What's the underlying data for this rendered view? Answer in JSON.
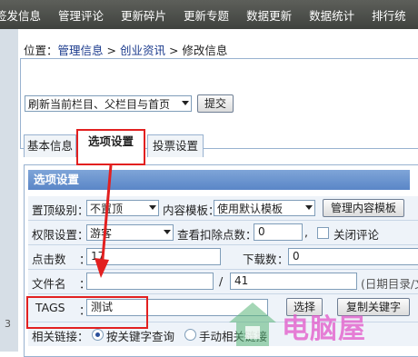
{
  "topnav": {
    "items": [
      "签发信息",
      "管理评论",
      "更新碎片",
      "更新专题",
      "数据更新",
      "数据统计",
      "排行统"
    ]
  },
  "sidebar": {
    "number": "3"
  },
  "breadcrumb": {
    "prefix": "位置：",
    "items": [
      "管理信息",
      "创业资讯",
      "修改信息"
    ],
    "separator": " > "
  },
  "toolbar": {
    "refresh_select": "刷新当前栏目、父栏目与首页",
    "submit_label": "提交"
  },
  "tabs": [
    {
      "label": "基本信息",
      "active": false
    },
    {
      "label": "选项设置",
      "active": true
    },
    {
      "label": "投票设置",
      "active": false
    }
  ],
  "panel": {
    "title": "选项设置",
    "rows": {
      "top": {
        "label": "置顶级别：",
        "value": "不置顶",
        "template_label": "内容模板：",
        "template_value": "使用默认模板",
        "manage_button": "管理内容模板"
      },
      "perm": {
        "label": "权限设置：",
        "value": "游客",
        "points_label": "查看扣除点数：",
        "points_value": "0",
        "close_comment": "关闭评论"
      },
      "clicks": {
        "label": "点击数",
        "sep": "：",
        "value": "17",
        "downloads_label": "下载数",
        "downloads_sep": "：",
        "downloads_value": "0"
      },
      "filename": {
        "label": "文件名",
        "sep": "：",
        "slash": "/",
        "value": "41",
        "hint": "(日期目录/文"
      },
      "tags": {
        "label": "TAGS",
        "sep": "：",
        "value": "测试",
        "choose_button": "选择",
        "copy_button": "复制关键字"
      },
      "related": {
        "label": "相关链接：",
        "option1": "按关键字查询",
        "option2": "手动相关链接"
      }
    }
  },
  "watermark": {
    "text": "电脑屋"
  },
  "colors": {
    "highlight": "#e22020",
    "nav_bg": "#4a4d49",
    "panel_head": "#6b94d0"
  }
}
